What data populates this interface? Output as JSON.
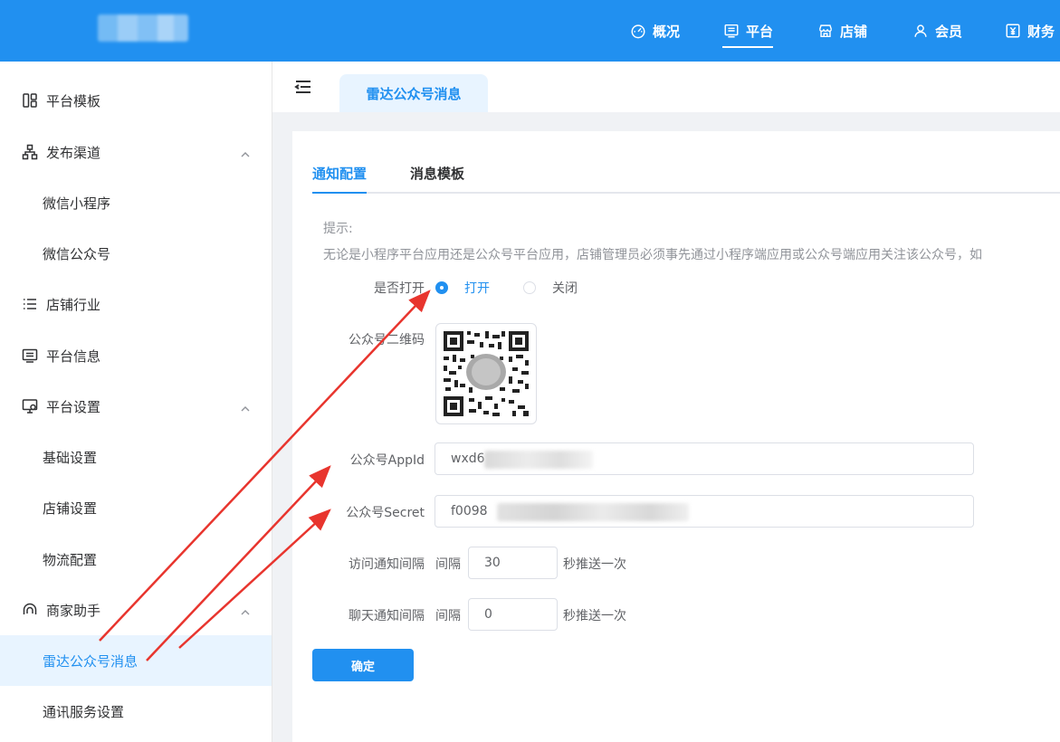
{
  "header": {
    "nav": [
      {
        "label": "概况",
        "icon": "dashboard-icon"
      },
      {
        "label": "平台",
        "icon": "platform-icon",
        "active": true
      },
      {
        "label": "店铺",
        "icon": "store-icon"
      },
      {
        "label": "会员",
        "icon": "user-icon"
      },
      {
        "label": "财务",
        "icon": "finance-icon"
      }
    ],
    "accent": "#2190f0"
  },
  "sidebar": {
    "items": [
      {
        "label": "平台模板",
        "icon": "template-icon"
      },
      {
        "label": "发布渠道",
        "icon": "sitemap-icon",
        "expanded": true
      },
      {
        "label": "微信小程序"
      },
      {
        "label": "微信公众号"
      },
      {
        "label": "店铺行业",
        "icon": "list-icon"
      },
      {
        "label": "平台信息",
        "icon": "info-card-icon"
      },
      {
        "label": "平台设置",
        "icon": "monitor-settings-icon",
        "expanded": true
      },
      {
        "label": "基础设置"
      },
      {
        "label": "店铺设置"
      },
      {
        "label": "物流配置"
      },
      {
        "label": "商家助手",
        "icon": "assistant-icon",
        "expanded": true
      },
      {
        "label": "雷达公众号消息",
        "active": true
      },
      {
        "label": "通讯服务设置"
      }
    ]
  },
  "page_tab": {
    "label": "雷达公众号消息"
  },
  "subtabs": [
    {
      "label": "通知配置",
      "active": true
    },
    {
      "label": "消息模板"
    }
  ],
  "tip": {
    "label": "提示:",
    "text": "无论是小程序平台应用还是公众号平台应用，店铺管理员必须事先通过小程序端应用或公众号端应用关注该公众号，如"
  },
  "form": {
    "open_label": "是否打开",
    "open_option": "打开",
    "close_option": "关闭",
    "open_selected": true,
    "qr_label": "公众号二维码",
    "appid_label": "公众号AppId",
    "appid_value": "wxd6",
    "secret_label": "公众号Secret",
    "secret_value": "f0098",
    "visit_label": "访问通知间隔",
    "visit_prefix": "间隔",
    "visit_value": "30",
    "visit_suffix": "秒推送一次",
    "chat_label": "聊天通知间隔",
    "chat_prefix": "间隔",
    "chat_value": "0",
    "chat_suffix": "秒推送一次",
    "confirm_label": "确定"
  },
  "annotation_color": "#e8352e"
}
